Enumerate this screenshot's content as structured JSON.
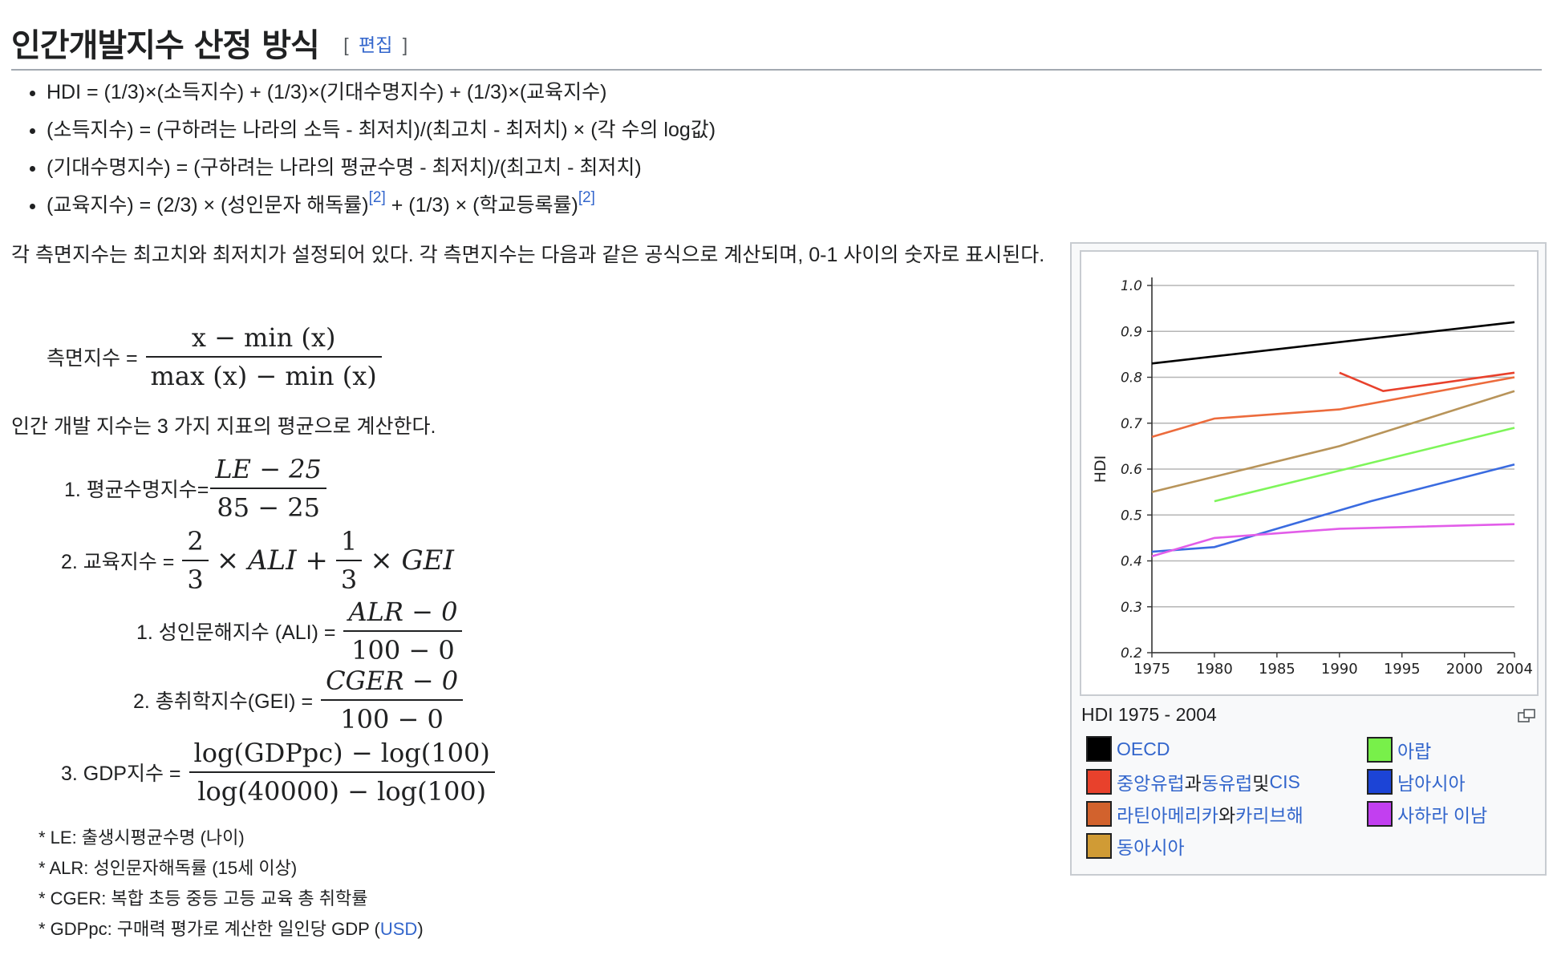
{
  "section": {
    "title": "인간개발지수 산정 방식",
    "edit_open": "[",
    "edit_label": "편집",
    "edit_close": "]"
  },
  "bullets": [
    {
      "text": "HDI = (1/3)×(소득지수) + (1/3)×(기대수명지수) + (1/3)×(교육지수)"
    },
    {
      "text": "(소득지수) = (구하려는 나라의 소득 - 최저치)/(최고치 - 최저치) × (각 수의 log값)"
    },
    {
      "text": "(기대수명지수) = (구하려는 나라의 평균수명 - 최저치)/(최고치 - 최저치)"
    },
    {
      "text_a": "(교육지수) = (2/3) × (성인문자 해독률)",
      "ref1": "[2]",
      "text_b": " + (1/3) × (학교등록률)",
      "ref2": "[2]"
    }
  ],
  "para1": "각 측면지수는 최고치와 최저치가 설정되어 있다. 각 측면지수는 다음과 같은 공식으로 계산되며, 0-1 사이의 숫자로 표시된다.",
  "formula_dim": {
    "label": "측면지수 =",
    "num": "x − min (x)",
    "den": "max (x) − min (x)"
  },
  "para2": "인간 개발 지수는 3 가지 지표의 평균으로 계산한다.",
  "formulas": {
    "life": {
      "label": "1. 평균수명지수=",
      "num": "LE − 25",
      "den": "85 − 25"
    },
    "edu": {
      "label": "2. 교육지수 =",
      "f1_num": "2",
      "f1_den": "3",
      "mid": "× ALI +",
      "f2_num": "1",
      "f2_den": "3",
      "tail": "× GEI"
    },
    "ali": {
      "label": "1. 성인문해지수 (ALI) =",
      "num": "ALR − 0",
      "den": "100 − 0"
    },
    "gei": {
      "label": "2. 총취학지수(GEI) =",
      "num": "CGER − 0",
      "den": "100 − 0"
    },
    "gdp": {
      "label": "3. GDP지수 =",
      "num": "log(GDPpc) − log(100)",
      "den": "log(40000) − log(100)"
    }
  },
  "notes": [
    {
      "text": "* LE: 출생시평균수명 (나이)"
    },
    {
      "text": "* ALR: 성인문자해독률 (15세 이상)"
    },
    {
      "text": "* CGER: 복합 초등 중등 고등 교육 총 취학률"
    },
    {
      "text_a": "* GDPpc: 구매력 평가로 계산한 일인당 GDP (",
      "link": "USD",
      "text_b": ")"
    }
  ],
  "chart_data": {
    "type": "line",
    "title": "",
    "xlabel": "",
    "ylabel": "HDI",
    "xlim": [
      1975,
      2004
    ],
    "ylim": [
      0.2,
      1.0
    ],
    "x_ticks": [
      1975,
      1980,
      1985,
      1990,
      1995,
      2000,
      2004
    ],
    "y_ticks": [
      0.2,
      0.3,
      0.4,
      0.5,
      0.6,
      0.7,
      0.8,
      0.9,
      1.0
    ],
    "y_tick_labels": [
      "0.2",
      "0.3",
      "0.4",
      "0.5",
      "0.6",
      "0.7",
      "0.8",
      "0.9",
      "1.0"
    ],
    "grid": true,
    "series": [
      {
        "key": "oecd",
        "color": "#000000",
        "points": [
          [
            1975,
            0.83
          ],
          [
            2004,
            0.92
          ]
        ]
      },
      {
        "key": "eastern_europe_cis",
        "color": "#e8412c",
        "points": [
          [
            1990,
            0.81
          ],
          [
            1993.5,
            0.77
          ],
          [
            2004,
            0.81
          ]
        ]
      },
      {
        "key": "latin_america",
        "color": "#ec6b3c",
        "points": [
          [
            1975,
            0.67
          ],
          [
            1980,
            0.71
          ],
          [
            1990,
            0.73
          ],
          [
            2004,
            0.8
          ]
        ]
      },
      {
        "key": "east_asia",
        "color": "#b8945a",
        "points": [
          [
            1975,
            0.55
          ],
          [
            1990,
            0.65
          ],
          [
            2004,
            0.77
          ]
        ]
      },
      {
        "key": "arab",
        "color": "#7ef55a",
        "points": [
          [
            1980,
            0.53
          ],
          [
            2004,
            0.69
          ]
        ]
      },
      {
        "key": "south_asia",
        "color": "#3a6be0",
        "points": [
          [
            1975,
            0.42
          ],
          [
            1980,
            0.43
          ],
          [
            1985,
            0.47
          ],
          [
            1992.5,
            0.53
          ],
          [
            2004,
            0.61
          ]
        ]
      },
      {
        "key": "sub_saharan",
        "color": "#e25de9",
        "points": [
          [
            1975,
            0.41
          ],
          [
            1980,
            0.45
          ],
          [
            1990,
            0.47
          ],
          [
            2004,
            0.48
          ]
        ]
      }
    ]
  },
  "caption": "HDI 1975 - 2004",
  "legend": [
    {
      "parts": [
        {
          "t": "OECD",
          "link": true
        }
      ],
      "color": "#000000"
    },
    {
      "parts": [
        {
          "t": "중앙유럽",
          "link": true
        },
        {
          "t": "과 ",
          "link": false
        },
        {
          "t": "동유럽",
          "link": true
        },
        {
          "t": "및 ",
          "link": false
        },
        {
          "t": "CIS",
          "link": true
        }
      ],
      "color": "#e8412c"
    },
    {
      "parts": [
        {
          "t": "라틴아메리카",
          "link": true
        },
        {
          "t": "와 ",
          "link": false
        },
        {
          "t": "카리브해",
          "link": true
        }
      ],
      "color": "#d2622d"
    },
    {
      "parts": [
        {
          "t": "동아시아",
          "link": true
        }
      ],
      "color": "#d09b35"
    },
    {
      "parts": [
        {
          "t": "아랍",
          "link": true
        }
      ],
      "color": "#78f04a"
    },
    {
      "parts": [
        {
          "t": "남아시아",
          "link": true
        }
      ],
      "color": "#1c44d6"
    },
    {
      "parts": [
        {
          "t": "사하라 이남",
          "link": true
        }
      ],
      "color": "#c23ff0"
    }
  ]
}
